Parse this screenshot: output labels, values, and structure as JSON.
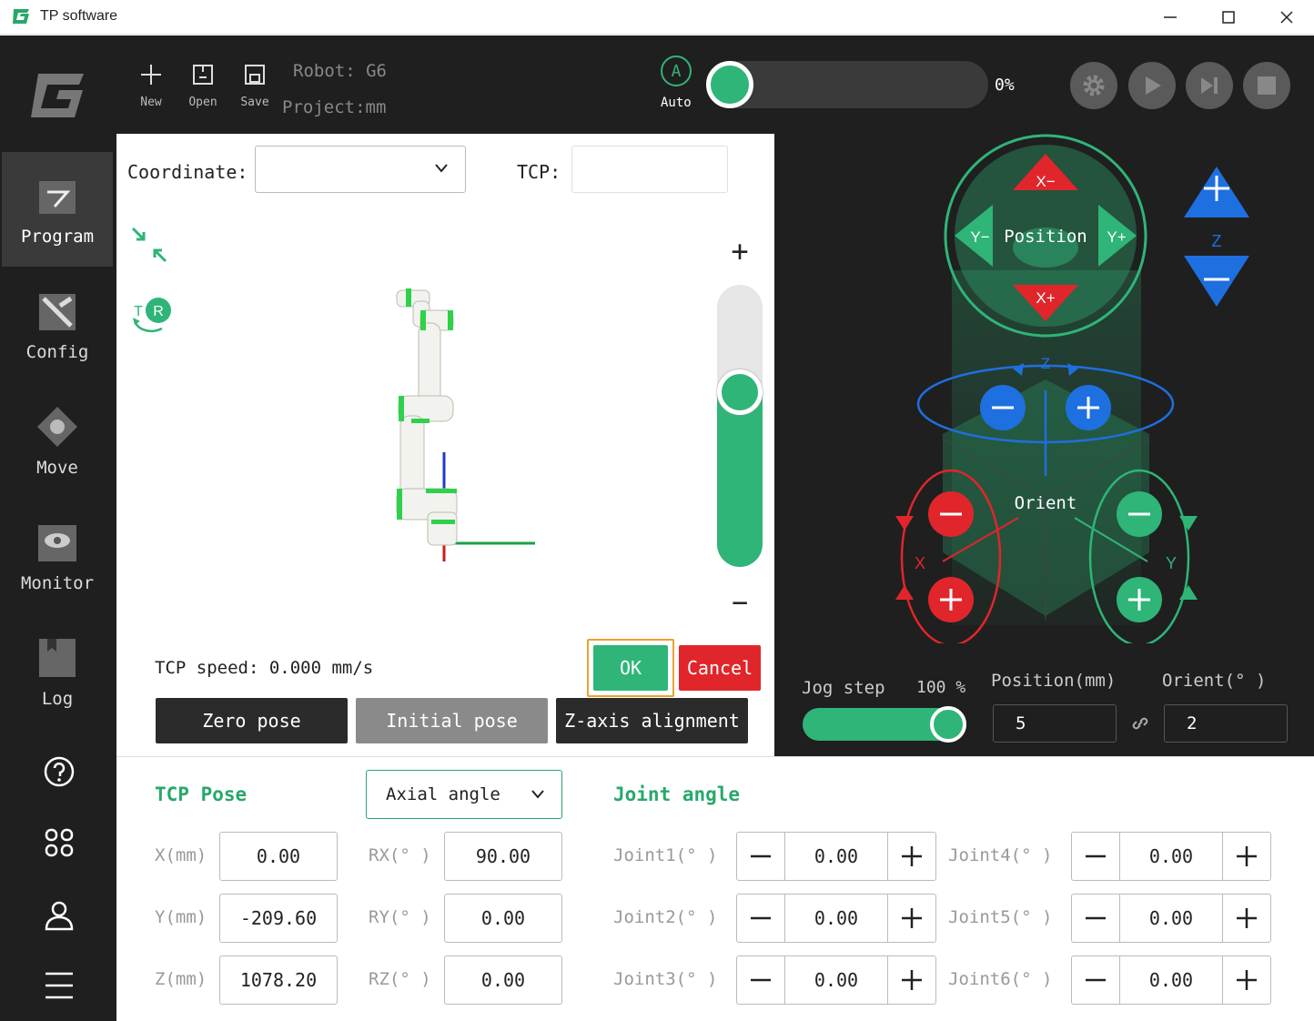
{
  "window": {
    "title": "TP software"
  },
  "sidebar": {
    "items": [
      {
        "label": "Program"
      },
      {
        "label": "Config"
      },
      {
        "label": "Move"
      },
      {
        "label": "Monitor"
      },
      {
        "label": "Log"
      }
    ]
  },
  "toolbar": {
    "new_label": "New",
    "open_label": "Open",
    "save_label": "Save",
    "robot": "Robot: G6",
    "project": "Project:mm",
    "mode_letter": "A",
    "mode_label": "Auto",
    "progress": "0%",
    "progress_value": 0
  },
  "viewer": {
    "coordinate_label": "Coordinate:",
    "coordinate_value": "",
    "tcp_label": "TCP:",
    "tcp_value": "",
    "zoom_in": "+",
    "zoom_out": "−",
    "zoom_level": 0.62,
    "tcp_speed": "TCP speed: 0.000 mm/s",
    "ok_label": "OK",
    "cancel_label": "Cancel",
    "zero_pose_label": "Zero pose",
    "initial_pose_label": "Initial pose",
    "z_align_label": "Z-axis alignment",
    "rotate_letters": {
      "t": "T",
      "r": "R"
    }
  },
  "jog": {
    "position_label": "Position",
    "orient_label": "Orient",
    "x_minus": "X−",
    "x_plus": "X+",
    "y_minus": "Y−",
    "y_plus": "Y+",
    "z_label": "Z",
    "x_label": "X",
    "y_label": "Y",
    "jog_step_label": "Jog step",
    "jog_step_value": "100 %",
    "jog_step_fraction": 1.0,
    "position_mm_label": "Position(mm)",
    "orient_deg_label": "Orient(° )",
    "position_step": "5",
    "orient_step": "2"
  },
  "tcp_pose": {
    "title": "TCP Pose",
    "mode": "Axial angle",
    "fields": [
      {
        "label": "X(mm)",
        "value": "0.00"
      },
      {
        "label": "Y(mm)",
        "value": "-209.60"
      },
      {
        "label": "Z(mm)",
        "value": "1078.20"
      },
      {
        "label": "RX(° )",
        "value": "90.00"
      },
      {
        "label": "RY(° )",
        "value": "0.00"
      },
      {
        "label": "RZ(° )",
        "value": "0.00"
      }
    ]
  },
  "joint_angle": {
    "title": "Joint angle",
    "joints": [
      {
        "label": "Joint1(° )",
        "value": "0.00"
      },
      {
        "label": "Joint2(° )",
        "value": "0.00"
      },
      {
        "label": "Joint3(° )",
        "value": "0.00"
      },
      {
        "label": "Joint4(° )",
        "value": "0.00"
      },
      {
        "label": "Joint5(° )",
        "value": "0.00"
      },
      {
        "label": "Joint6(° )",
        "value": "0.00"
      }
    ]
  },
  "colors": {
    "green": "#2fb577",
    "red": "#e0262b",
    "blue": "#1e6fe0",
    "dark": "#1f1f1f"
  }
}
